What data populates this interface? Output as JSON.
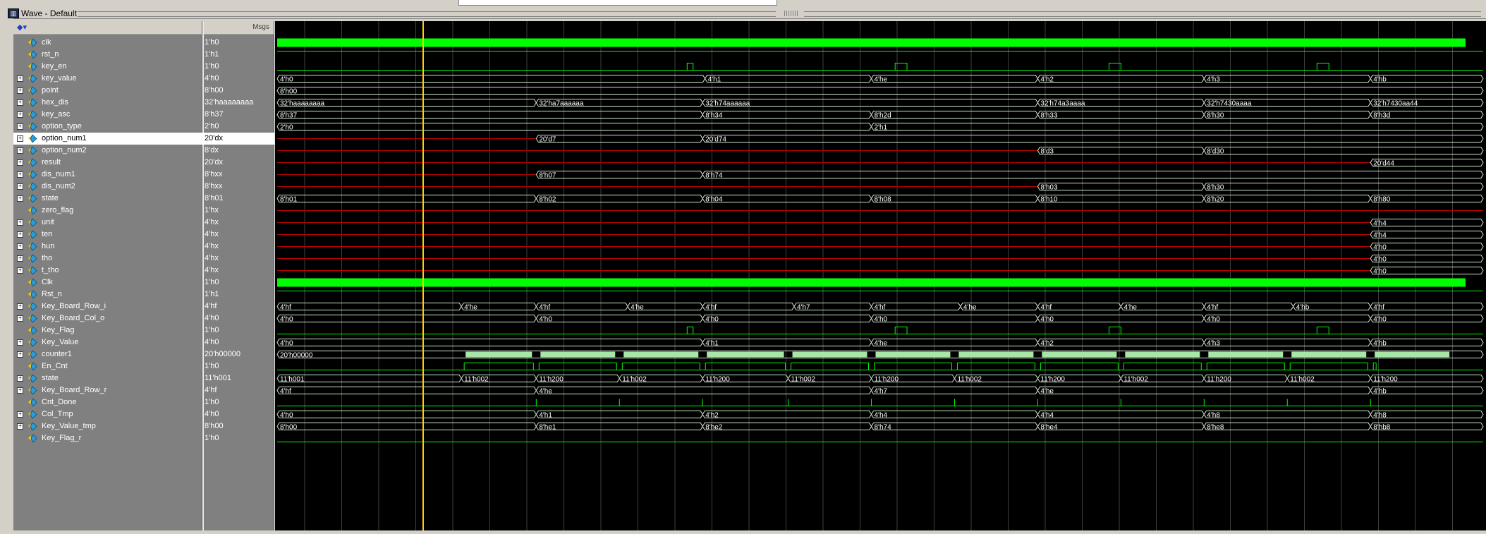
{
  "window": {
    "title": "Wave - Default",
    "msgs_header": "Msgs"
  },
  "colors": {
    "clock": "#00ff00",
    "bus": "#cfe8cf",
    "unknown": "#c00000",
    "grid": "#404040",
    "cursor": "#ffd000",
    "bus_fill_green": "#a8e6a8"
  },
  "signals": [
    {
      "name": "clk",
      "value": "1'h0",
      "icon": "wire-icon",
      "expandable": false
    },
    {
      "name": "rst_n",
      "value": "1'h1",
      "icon": "wire-icon",
      "expandable": false
    },
    {
      "name": "key_en",
      "value": "1'h0",
      "icon": "wire-icon",
      "expandable": false
    },
    {
      "name": "key_value",
      "value": "4'h0",
      "icon": "bus-icon",
      "expandable": true
    },
    {
      "name": "point",
      "value": "8'h00",
      "icon": "bus-icon",
      "expandable": true
    },
    {
      "name": "hex_dis",
      "value": "32'haaaaaaaa",
      "icon": "bus-icon",
      "expandable": true
    },
    {
      "name": "key_asc",
      "value": "8'h37",
      "icon": "bus-icon",
      "expandable": true
    },
    {
      "name": "option_type",
      "value": "2'h0",
      "icon": "bus-icon",
      "expandable": true
    },
    {
      "name": "option_num1",
      "value": "20'dx",
      "icon": "bus-icon",
      "expandable": true
    },
    {
      "name": "option_num2",
      "value": "8'dx",
      "icon": "bus-icon",
      "expandable": true
    },
    {
      "name": "result",
      "value": "20'dx",
      "icon": "bus-icon",
      "expandable": true
    },
    {
      "name": "dis_num1",
      "value": "8'hxx",
      "icon": "bus-icon",
      "expandable": true
    },
    {
      "name": "dis_num2",
      "value": "8'hxx",
      "icon": "bus-icon",
      "expandable": true
    },
    {
      "name": "state",
      "value": "8'h01",
      "icon": "bus-icon",
      "expandable": true
    },
    {
      "name": "zero_flag",
      "value": "1'hx",
      "icon": "wire-icon",
      "expandable": false
    },
    {
      "name": "unit",
      "value": "4'hx",
      "icon": "bus-icon",
      "expandable": true
    },
    {
      "name": "ten",
      "value": "4'hx",
      "icon": "bus-icon",
      "expandable": true
    },
    {
      "name": "hun",
      "value": "4'hx",
      "icon": "bus-icon",
      "expandable": true
    },
    {
      "name": "tho",
      "value": "4'hx",
      "icon": "bus-icon",
      "expandable": true
    },
    {
      "name": "t_tho",
      "value": "4'hx",
      "icon": "bus-icon",
      "expandable": true
    },
    {
      "name": "Clk",
      "value": "1'h0",
      "icon": "wire-icon",
      "expandable": false
    },
    {
      "name": "Rst_n",
      "value": "1'h1",
      "icon": "wire-icon",
      "expandable": false
    },
    {
      "name": "Key_Board_Row_i",
      "value": "4'hf",
      "icon": "bus-icon",
      "expandable": true
    },
    {
      "name": "Key_Board_Col_o",
      "value": "4'h0",
      "icon": "bus-icon",
      "expandable": true
    },
    {
      "name": "Key_Flag",
      "value": "1'h0",
      "icon": "wire-icon",
      "expandable": false
    },
    {
      "name": "Key_Value",
      "value": "4'h0",
      "icon": "bus-icon",
      "expandable": true
    },
    {
      "name": "counter1",
      "value": "20'h00000",
      "icon": "bus-icon",
      "expandable": true
    },
    {
      "name": "En_Cnt",
      "value": "1'h0",
      "icon": "wire-icon",
      "expandable": false
    },
    {
      "name": "state",
      "value": "11'h001",
      "icon": "bus-icon",
      "expandable": true
    },
    {
      "name": "Key_Board_Row_r",
      "value": "4'hf",
      "icon": "bus-icon",
      "expandable": true
    },
    {
      "name": "Cnt_Done",
      "value": "1'h0",
      "icon": "wire-icon",
      "expandable": false
    },
    {
      "name": "Col_Tmp",
      "value": "4'h0",
      "icon": "bus-icon",
      "expandable": true
    },
    {
      "name": "Key_Value_tmp",
      "value": "8'h00",
      "icon": "bus-icon",
      "expandable": true
    },
    {
      "name": "Key_Flag_r",
      "value": "1'h0",
      "icon": "wire-icon",
      "expandable": false
    }
  ],
  "selected_index": 8,
  "waves": [
    {
      "kind": "clock"
    },
    {
      "kind": "bit",
      "segs": [
        [
          0,
          1
        ]
      ]
    },
    {
      "kind": "bit",
      "segs": [
        [
          0,
          0
        ],
        [
          0.345,
          0.35
        ],
        [
          0.52,
          0.53
        ],
        [
          0.7,
          0.71
        ],
        [
          0.875,
          0.885
        ]
      ],
      "pulses": true
    },
    {
      "kind": "bus",
      "segs": [
        [
          0,
          "4'h0"
        ],
        [
          0.36,
          "4'h1"
        ],
        [
          0.5,
          "4'he"
        ],
        [
          0.64,
          "4'h2"
        ],
        [
          0.78,
          "4'h3"
        ],
        [
          0.92,
          "4'hb"
        ]
      ]
    },
    {
      "kind": "bus",
      "segs": [
        [
          0,
          "8'h00"
        ]
      ]
    },
    {
      "kind": "bus",
      "segs": [
        [
          0,
          "32'haaaaaaaa"
        ],
        [
          0.218,
          "32'ha7aaaaaa"
        ],
        [
          0.358,
          "32'h74aaaaaa"
        ],
        [
          0.64,
          "32'h74a3aaaa"
        ],
        [
          0.78,
          "32'h7430aaaa"
        ],
        [
          0.92,
          "32'h7430aa44"
        ]
      ]
    },
    {
      "kind": "bus",
      "segs": [
        [
          0,
          "8'h37"
        ],
        [
          0.358,
          "8'h34"
        ],
        [
          0.5,
          "8'h2d"
        ],
        [
          0.64,
          "8'h33"
        ],
        [
          0.78,
          "8'h30"
        ],
        [
          0.92,
          "8'h3d"
        ]
      ]
    },
    {
      "kind": "bus",
      "segs": [
        [
          0,
          "2'h0"
        ],
        [
          0.5,
          "2'h1"
        ]
      ]
    },
    {
      "kind": "bus",
      "segs": [
        [
          0,
          "x"
        ],
        [
          0.218,
          "20'd7"
        ],
        [
          0.358,
          "20'd74"
        ]
      ]
    },
    {
      "kind": "bus",
      "segs": [
        [
          0,
          "x"
        ],
        [
          0.64,
          "8'd3"
        ],
        [
          0.78,
          "8'd30"
        ]
      ]
    },
    {
      "kind": "bus",
      "segs": [
        [
          0,
          "x"
        ],
        [
          0.92,
          "20'd44"
        ]
      ]
    },
    {
      "kind": "bus",
      "segs": [
        [
          0,
          "x"
        ],
        [
          0.218,
          "8'h07"
        ],
        [
          0.358,
          "8'h74"
        ]
      ]
    },
    {
      "kind": "bus",
      "segs": [
        [
          0,
          "x"
        ],
        [
          0.64,
          "8'h03"
        ],
        [
          0.78,
          "8'h30"
        ]
      ]
    },
    {
      "kind": "bus",
      "segs": [
        [
          0,
          "8'h01"
        ],
        [
          0.218,
          "8'h02"
        ],
        [
          0.358,
          "8'h04"
        ],
        [
          0.5,
          "8'h08"
        ],
        [
          0.64,
          "8'h10"
        ],
        [
          0.78,
          "8'h20"
        ],
        [
          0.92,
          "8'h80"
        ]
      ]
    },
    {
      "kind": "xbit"
    },
    {
      "kind": "bus",
      "segs": [
        [
          0,
          "x"
        ],
        [
          0.92,
          "4'h4"
        ]
      ]
    },
    {
      "kind": "bus",
      "segs": [
        [
          0,
          "x"
        ],
        [
          0.92,
          "4'h4"
        ]
      ]
    },
    {
      "kind": "bus",
      "segs": [
        [
          0,
          "x"
        ],
        [
          0.92,
          "4'h0"
        ]
      ]
    },
    {
      "kind": "bus",
      "segs": [
        [
          0,
          "x"
        ],
        [
          0.92,
          "4'h0"
        ]
      ]
    },
    {
      "kind": "bus",
      "segs": [
        [
          0,
          "x"
        ],
        [
          0.92,
          "4'h0"
        ]
      ]
    },
    {
      "kind": "clock"
    },
    {
      "kind": "bit",
      "segs": [
        [
          0,
          1
        ]
      ]
    },
    {
      "kind": "bus",
      "segs": [
        [
          0,
          "4'hf"
        ],
        [
          0.155,
          "4'he"
        ],
        [
          0.218,
          "4'hf"
        ],
        [
          0.295,
          "4'he"
        ],
        [
          0.358,
          "4'hf"
        ],
        [
          0.435,
          "4'h7"
        ],
        [
          0.5,
          "4'hf"
        ],
        [
          0.575,
          "4'he"
        ],
        [
          0.64,
          "4'hf"
        ],
        [
          0.71,
          "4'he"
        ],
        [
          0.78,
          "4'hf"
        ],
        [
          0.855,
          "4'hb"
        ],
        [
          0.92,
          "4'hf"
        ]
      ]
    },
    {
      "kind": "bus",
      "segs": [
        [
          0,
          "4'h0"
        ],
        [
          0.218,
          "4'h0"
        ],
        [
          0.358,
          "4'h0"
        ],
        [
          0.5,
          "4'h0"
        ],
        [
          0.64,
          "4'h0"
        ],
        [
          0.78,
          "4'h0"
        ],
        [
          0.92,
          "4'h0"
        ]
      ]
    },
    {
      "kind": "bit",
      "segs": [
        [
          0,
          0
        ],
        [
          0.345,
          0.35
        ],
        [
          0.52,
          0.53
        ],
        [
          0.7,
          0.71
        ],
        [
          0.875,
          0.885
        ]
      ],
      "pulses": true
    },
    {
      "kind": "bus",
      "segs": [
        [
          0,
          "4'h0"
        ],
        [
          0.358,
          "4'h1"
        ],
        [
          0.5,
          "4'he"
        ],
        [
          0.64,
          "4'h2"
        ],
        [
          0.78,
          "4'h3"
        ],
        [
          0.92,
          "4'hb"
        ]
      ]
    },
    {
      "kind": "counter",
      "segs": [
        [
          0,
          "20'h00000"
        ]
      ],
      "bursts": [
        0.155,
        0.218,
        0.288,
        0.358,
        0.43,
        0.5,
        0.57,
        0.64,
        0.71,
        0.78,
        0.85,
        0.92,
        0.99
      ]
    },
    {
      "kind": "encnt",
      "bursts": [
        0.155,
        0.218,
        0.288,
        0.358,
        0.43,
        0.5,
        0.57,
        0.64,
        0.71,
        0.78,
        0.85,
        0.92
      ]
    },
    {
      "kind": "bus",
      "segs": [
        [
          0,
          "11'h001"
        ],
        [
          0.155,
          "11'h002"
        ],
        [
          0.218,
          "11'h200"
        ],
        [
          0.288,
          "11'h002"
        ],
        [
          0.358,
          "11'h200"
        ],
        [
          0.43,
          "11'h002"
        ],
        [
          0.5,
          "11'h200"
        ],
        [
          0.57,
          "11'h002"
        ],
        [
          0.64,
          "11'h200"
        ],
        [
          0.71,
          "11'h002"
        ],
        [
          0.78,
          "11'h200"
        ],
        [
          0.85,
          "11'h002"
        ],
        [
          0.92,
          "11'h200"
        ]
      ]
    },
    {
      "kind": "bus",
      "segs": [
        [
          0,
          "4'hf"
        ],
        [
          0.218,
          "4'he"
        ],
        [
          0.5,
          "4'h7"
        ],
        [
          0.64,
          "4'he"
        ],
        [
          0.92,
          "4'hb"
        ]
      ]
    },
    {
      "kind": "bit",
      "segs": [
        [
          0,
          0
        ]
      ],
      "ticks": [
        0.218,
        0.288,
        0.358,
        0.43,
        0.5,
        0.57,
        0.64,
        0.71,
        0.78,
        0.85,
        0.92
      ]
    },
    {
      "kind": "bus",
      "segs": [
        [
          0,
          "4'h0"
        ],
        [
          0.218,
          "4'h1"
        ],
        [
          0.358,
          "4'h2"
        ],
        [
          0.5,
          "4'h4"
        ],
        [
          0.64,
          "4'h4"
        ],
        [
          0.78,
          "4'h8"
        ],
        [
          0.92,
          "4'h8"
        ]
      ]
    },
    {
      "kind": "bus",
      "segs": [
        [
          0,
          "8'h00"
        ],
        [
          0.218,
          "8'he1"
        ],
        [
          0.358,
          "8'he2"
        ],
        [
          0.5,
          "8'h74"
        ],
        [
          0.64,
          "8'he4"
        ],
        [
          0.78,
          "8'he8"
        ],
        [
          0.92,
          "8'hb8"
        ]
      ]
    },
    {
      "kind": "bit",
      "segs": [
        [
          0,
          0
        ]
      ]
    }
  ]
}
